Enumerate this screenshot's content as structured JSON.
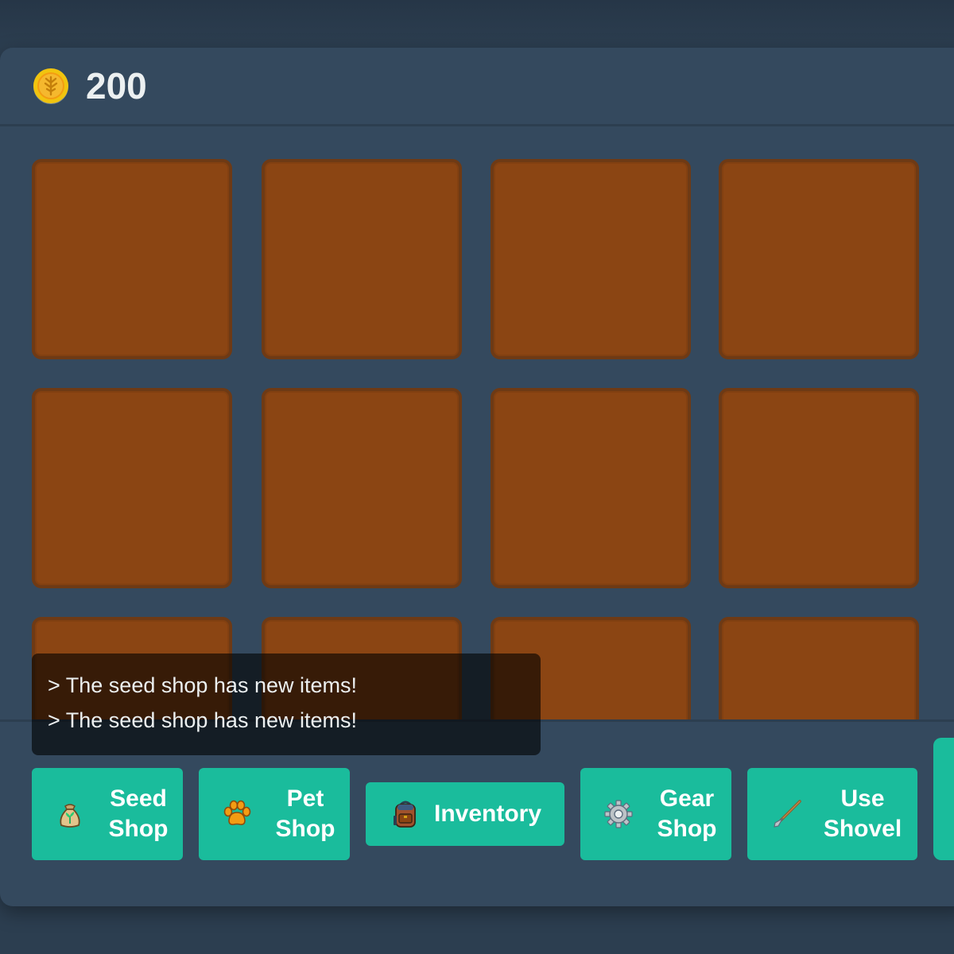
{
  "header": {
    "coin_icon": "coin-icon",
    "coins": "200"
  },
  "farm": {
    "plots": [
      {
        "state": "empty"
      },
      {
        "state": "empty"
      },
      {
        "state": "empty"
      },
      {
        "state": "empty"
      },
      {
        "state": "empty"
      },
      {
        "state": "empty"
      },
      {
        "state": "empty"
      },
      {
        "state": "empty"
      },
      {
        "state": "empty"
      },
      {
        "state": "empty"
      },
      {
        "state": "empty"
      },
      {
        "state": "empty"
      }
    ]
  },
  "log": {
    "lines": [
      "> The seed shop has new items!",
      "> The seed shop has new items!"
    ]
  },
  "toolbar": {
    "seed_shop": {
      "line1": "Seed",
      "line2": "Shop",
      "icon": "seed-bag-icon"
    },
    "pet_shop": {
      "line1": "Pet",
      "line2": "Shop",
      "icon": "paw-icon"
    },
    "inventory": {
      "label": "Inventory",
      "icon": "backpack-icon"
    },
    "gear_shop": {
      "line1": "Gear",
      "line2": "Shop",
      "icon": "gear-icon"
    },
    "use_shovel": {
      "line1": "Use",
      "line2": "Shovel",
      "icon": "shovel-icon"
    }
  },
  "colors": {
    "background": "#2c3e50",
    "panel": "#34495e",
    "soil": "#8b4513",
    "button": "#1abc9c",
    "text": "#ecf0f1"
  }
}
